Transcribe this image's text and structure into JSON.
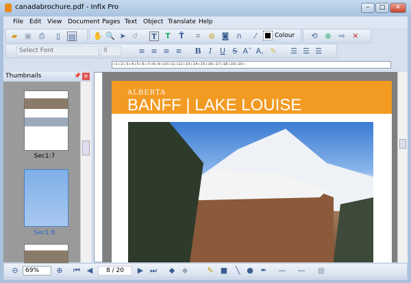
{
  "window": {
    "title": "canadabrochure.pdf - Infix Pro",
    "minimize": "–",
    "maximize": "□",
    "close": "✕"
  },
  "menu": [
    "File",
    "Edit",
    "View",
    "Document",
    "Pages",
    "Text",
    "Object",
    "Translate",
    "Help"
  ],
  "toolbar": {
    "colour_label": "Colour",
    "font_placeholder": "Select Font",
    "font_size": "8"
  },
  "ruler": {
    "labels": "·ı·1·ı·2·ı·3·ı·4·ı·5·ı·6·ı·7·ı·8·ı·9·ı·10·ı·11·ı·12·ı·13·ı·14·ı·15·ı·16·ı·17·ı·18·ı·19·ı·20·ı·"
  },
  "thumbnails": {
    "title": "Thumbnails",
    "items": [
      {
        "label": "Sec1:7"
      },
      {
        "label": "Sec1:8",
        "selected": true
      }
    ]
  },
  "document": {
    "kicker": "ALBERTA",
    "headline": "BANFF | LAKE LOUISE",
    "banner_color": "#f39a22"
  },
  "statusbar": {
    "zoom": "69%",
    "page": "8 / 20"
  }
}
